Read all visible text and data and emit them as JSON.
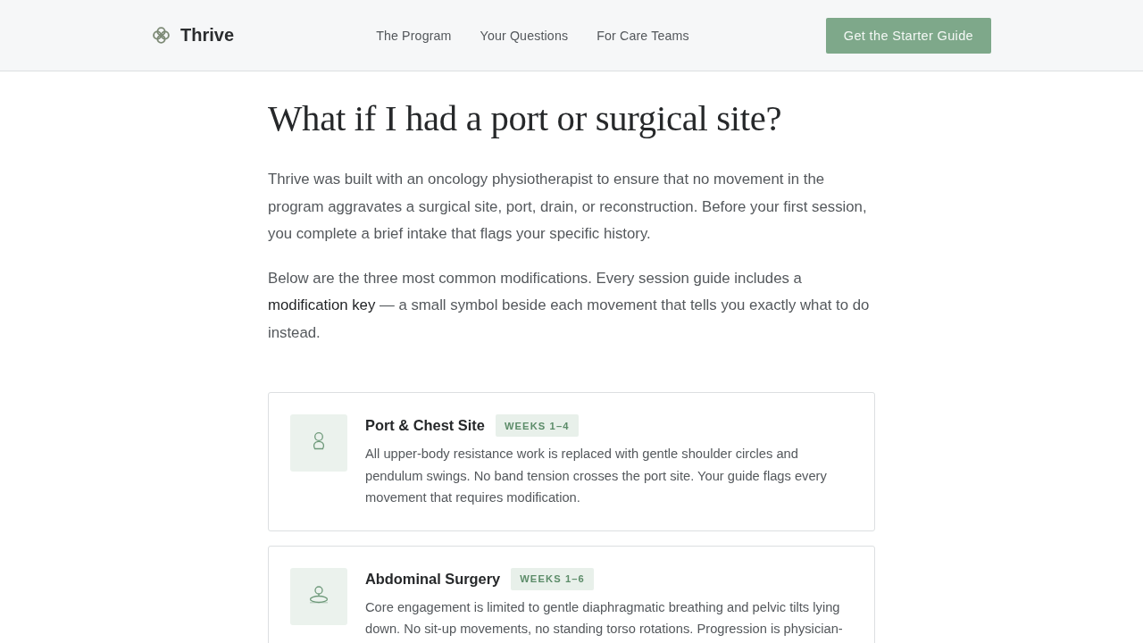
{
  "header": {
    "brand": "Thrive",
    "nav": [
      "The Program",
      "Your Questions",
      "For Care Teams"
    ],
    "cta": "Get the Starter Guide"
  },
  "question": {
    "title": "What if I had a port or surgical site?",
    "paragraphs": [
      "Thrive was built with an oncology physiotherapist to ensure that no movement in the program aggravates a surgical site, port, drain, or reconstruction. Before your first session, you complete a brief intake that flags your specific history.",
      "Below are the three most common modifications. Every session guide includes a **modification key** — a small symbol beside each movement that tells you exactly what to do instead."
    ]
  },
  "modifications": [
    {
      "kind": "upper",
      "title": "Port & Chest Site",
      "badge": "WEEKS 1–4",
      "text": "All upper-body resistance work is replaced with gentle shoulder circles and pendulum swings. No band tension crosses the port site. Your guide flags every movement that requires modification."
    },
    {
      "kind": "core",
      "title": "Abdominal Surgery",
      "badge": "WEEKS 1–6",
      "text": "Core engagement is limited to gentle diaphragmatic breathing and pelvic tilts lying down. No sit-up movements, no standing torso rotations. Progression is physician-"
    }
  ]
}
